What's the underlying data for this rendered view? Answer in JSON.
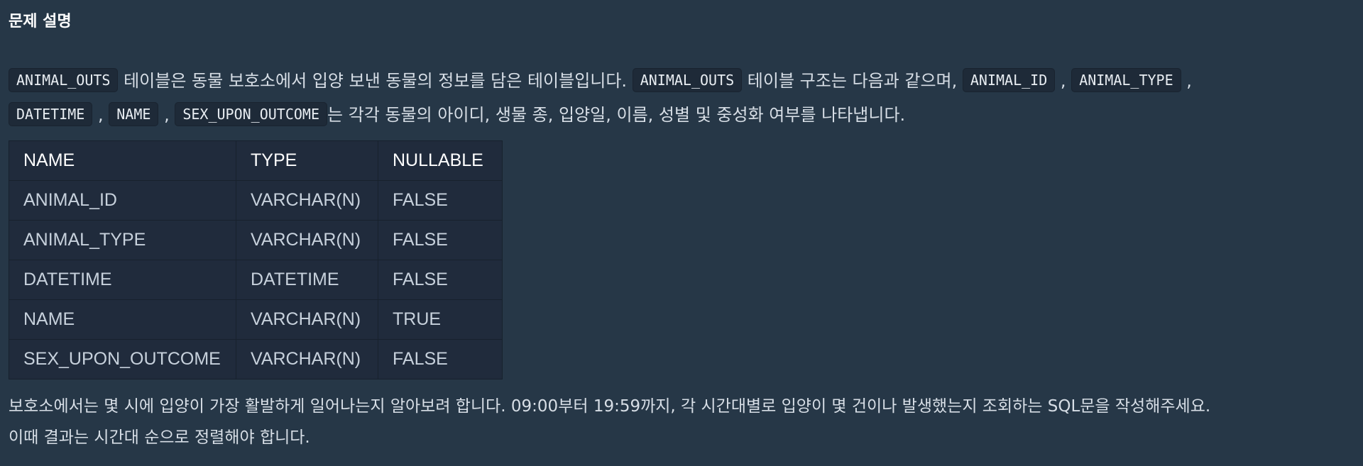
{
  "section_title": "문제 설명",
  "intro": {
    "table_name_1": "ANIMAL_OUTS",
    "text_1": " 테이블은 동물 보호소에서 입양 보낸 동물의 정보를 담은 테이블입니다. ",
    "table_name_2": "ANIMAL_OUTS",
    "text_2": " 테이블 구조는 다음과 같으며, ",
    "col_1": "ANIMAL_ID",
    "col_2": "ANIMAL_TYPE",
    "col_3": "DATETIME",
    "col_4": "NAME",
    "col_5": "SEX_UPON_OUTCOME",
    "sep": ",",
    "text_3": "는 각각 동물의 아이디, 생물 종, 입양일, 이름, 성별 및 중성화 여부를 나타냅니다."
  },
  "schema_table": {
    "headers": [
      "NAME",
      "TYPE",
      "NULLABLE"
    ],
    "rows": [
      [
        "ANIMAL_ID",
        "VARCHAR(N)",
        "FALSE"
      ],
      [
        "ANIMAL_TYPE",
        "VARCHAR(N)",
        "FALSE"
      ],
      [
        "DATETIME",
        "DATETIME",
        "FALSE"
      ],
      [
        "NAME",
        "VARCHAR(N)",
        "TRUE"
      ],
      [
        "SEX_UPON_OUTCOME",
        "VARCHAR(N)",
        "FALSE"
      ]
    ]
  },
  "question": {
    "line_1": "보호소에서는 몇 시에 입양이 가장 활발하게 일어나는지 알아보려 합니다. 09:00부터 19:59까지, 각 시간대별로 입양이 몇 건이나 발생했는지 조회하는 SQL문을 작성해주세요.",
    "line_2": "이때 결과는 시간대 순으로 정렬해야 합니다."
  },
  "colors": {
    "background": "#263747",
    "code_background": "#1e2a38",
    "table_background": "#202b3c"
  }
}
